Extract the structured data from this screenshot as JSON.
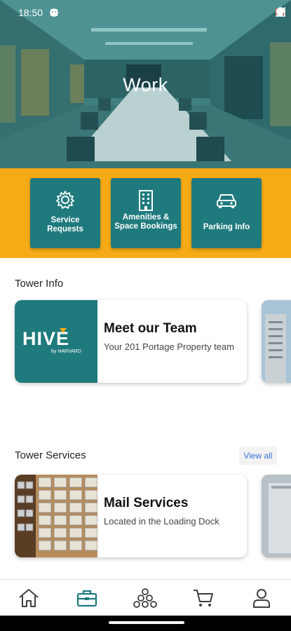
{
  "status_bar": {
    "time": "18:50"
  },
  "hero": {
    "title": "Work"
  },
  "tiles": [
    {
      "label": "Service Requests",
      "icon": "gear-icon"
    },
    {
      "label": "Amenities & Space Bookings",
      "icon": "building-icon"
    },
    {
      "label": "Parking Info",
      "icon": "car-icon"
    }
  ],
  "tower_info": {
    "title": "Tower Info",
    "card": {
      "title": "Meet our Team",
      "subtitle": "Your 201 Portage Property team",
      "logo_text": "HIVE",
      "logo_sub": "by HARVARD"
    }
  },
  "tower_services": {
    "title": "Tower Services",
    "view_all": "View all",
    "card": {
      "title": "Mail Services",
      "subtitle": "Located in the Loading Dock"
    }
  },
  "colors": {
    "teal": "#1f7a7d",
    "yellow": "#f6ab16",
    "link_blue": "#3a6fd8"
  },
  "bottom_nav": [
    {
      "name": "home",
      "icon": "home-icon"
    },
    {
      "name": "work",
      "icon": "briefcase-icon",
      "active": true
    },
    {
      "name": "community",
      "icon": "community-icon"
    },
    {
      "name": "shop",
      "icon": "cart-icon"
    },
    {
      "name": "profile",
      "icon": "person-icon"
    }
  ]
}
